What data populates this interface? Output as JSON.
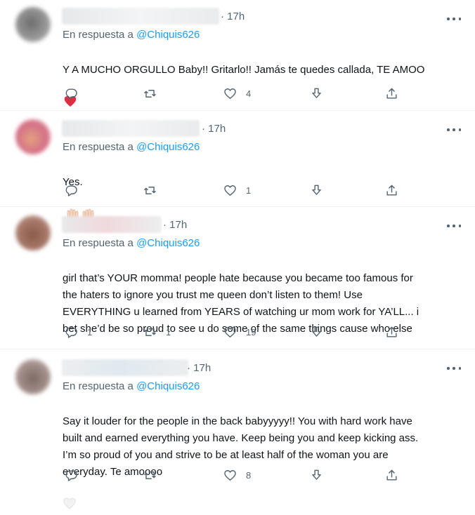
{
  "reply_prefix": "En respuesta a",
  "tweets": [
    {
      "time": "· 17h",
      "handle": "@Chiquis626",
      "text": "Y A MUCHO ORGULLO Baby!! Gritarlo!! Jamás te quedes callada, TE AMOO",
      "emoji": "❤",
      "reply_count": "",
      "retweet_count": "",
      "like_count": "4"
    },
    {
      "time": "· 17h",
      "handle": "@Chiquis626",
      "text": "Yes.",
      "emoji": "🙌🏻🙌🏻",
      "reply_count": "",
      "retweet_count": "",
      "like_count": "1"
    },
    {
      "time": "· 17h",
      "handle": "@Chiquis626",
      "text": "girl that’s YOUR momma! people hate because you became too famous for\nthe haters to ignore you trust me queen don’t listen to them! Use\nEVERYTHING u learned from YEARS of watching ur mom work for YA’LL... i\nbet she’d be so proud to see u do some of the same things cause who else",
      "emoji": "",
      "reply_count": "1",
      "retweet_count": "1",
      "like_count": "19"
    },
    {
      "time": "· 17h",
      "handle": "@Chiquis626",
      "text": "Say it louder for the people in the back babyyyyy!! You with hard work have\nbuilt and earned everything you have. Keep being you and keep kicking ass.\nI’m so proud of you and strive to be at least half of the woman you are\neveryday. Te amoooo",
      "emoji": "🤍",
      "reply_count": "",
      "retweet_count": "",
      "like_count": "8"
    }
  ],
  "colors": {
    "secondary_text": "#536471",
    "link": "#1d9bf0",
    "divider": "#eff3f4",
    "heart_red": "#e0245e"
  },
  "icons": [
    "reply-icon",
    "retweet-icon",
    "like-icon",
    "download-icon",
    "share-icon",
    "more-icon"
  ]
}
